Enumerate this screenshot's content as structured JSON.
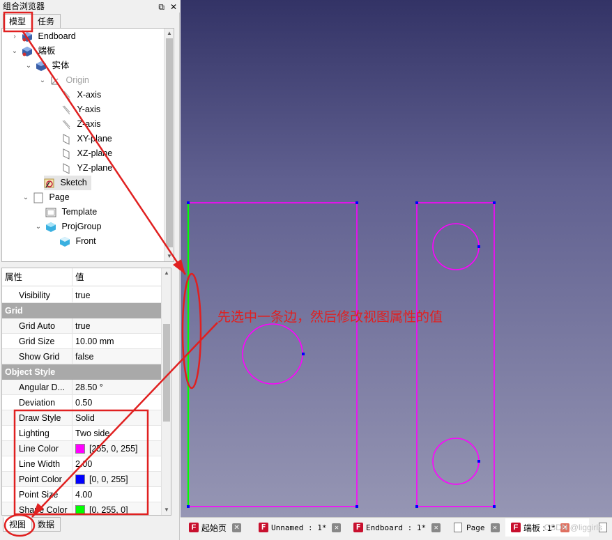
{
  "panel": {
    "title": "组合浏览器",
    "float_icon": "⧉",
    "close_icon": "✕"
  },
  "top_tabs": [
    {
      "label": "模型"
    },
    {
      "label": "任务"
    }
  ],
  "tree": {
    "items": [
      {
        "label": "Endboard",
        "arrow": "›",
        "icon": "body-icon"
      },
      {
        "label": "端板",
        "arrow": "⌄",
        "icon": "body-icon"
      },
      {
        "label": "实体",
        "arrow": "⌄",
        "icon": "body-icon"
      },
      {
        "label": "Origin",
        "arrow": "⌄",
        "icon": "origin-icon"
      },
      {
        "label": "X-axis",
        "icon": "axis-icon"
      },
      {
        "label": "Y-axis",
        "icon": "axis-icon"
      },
      {
        "label": "Z-axis",
        "icon": "axis-icon"
      },
      {
        "label": "XY-plane",
        "icon": "plane-icon"
      },
      {
        "label": "XZ-plane",
        "icon": "plane-icon"
      },
      {
        "label": "YZ-plane",
        "icon": "plane-icon"
      },
      {
        "label": "Sketch",
        "icon": "sketch-icon"
      },
      {
        "label": "Page",
        "arrow": "⌄",
        "icon": "page-icon"
      },
      {
        "label": "Template",
        "icon": "template-icon"
      },
      {
        "label": "ProjGroup",
        "arrow": "⌄",
        "icon": "projgroup-icon"
      },
      {
        "label": "Front",
        "icon": "view-icon"
      }
    ]
  },
  "props": {
    "header": {
      "name": "属性",
      "value": "值"
    },
    "rows": [
      {
        "type": "prop",
        "name": "Visibility",
        "value": "true"
      },
      {
        "type": "group",
        "name": "Grid"
      },
      {
        "type": "prop",
        "name": "Grid Auto",
        "value": "true"
      },
      {
        "type": "prop",
        "name": "Grid Size",
        "value": "10.00 mm"
      },
      {
        "type": "prop",
        "name": "Show Grid",
        "value": "false"
      },
      {
        "type": "group",
        "name": "Object Style"
      },
      {
        "type": "prop",
        "name": "Angular D...",
        "value": "28.50 °"
      },
      {
        "type": "prop",
        "name": "Deviation",
        "value": "0.50"
      },
      {
        "type": "prop",
        "name": "Draw Style",
        "value": "Solid"
      },
      {
        "type": "prop",
        "name": "Lighting",
        "value": "Two side"
      },
      {
        "type": "prop",
        "name": "Line Color",
        "value": "[255, 0, 255]",
        "swatch": "#ff00ff"
      },
      {
        "type": "prop",
        "name": "Line Width",
        "value": "2.00"
      },
      {
        "type": "prop",
        "name": "Point Color",
        "value": "[0, 0, 255]",
        "swatch": "#0000ff"
      },
      {
        "type": "prop",
        "name": "Point Size",
        "value": "4.00"
      },
      {
        "type": "prop",
        "name": "Shape Color",
        "value": "[0, 255, 0]",
        "swatch": "#00ff00"
      }
    ]
  },
  "bottom_tabs": [
    {
      "label": "视图"
    },
    {
      "label": "数据"
    }
  ],
  "doc_tabs": [
    {
      "label": "起始页",
      "icon": "freecad-icon"
    },
    {
      "label": "Unnamed : 1*",
      "icon": "freecad-icon"
    },
    {
      "label": "Endboard : 1*",
      "icon": "freecad-icon"
    },
    {
      "label": "Page",
      "icon": "page-icon"
    },
    {
      "label": "端板 : 1*",
      "icon": "freecad-icon"
    },
    {
      "label": "P",
      "icon": "page-icon"
    }
  ],
  "annotation": {
    "text": "先选中一条边，然后修改视图属性的值"
  },
  "watermark": {
    "text": "CSDN @liggirls"
  },
  "colors": {
    "sketch_line": "#ff00ff",
    "selected_edge": "#00ff00",
    "vertex": "#0000ff",
    "annotation": "#e02020"
  }
}
